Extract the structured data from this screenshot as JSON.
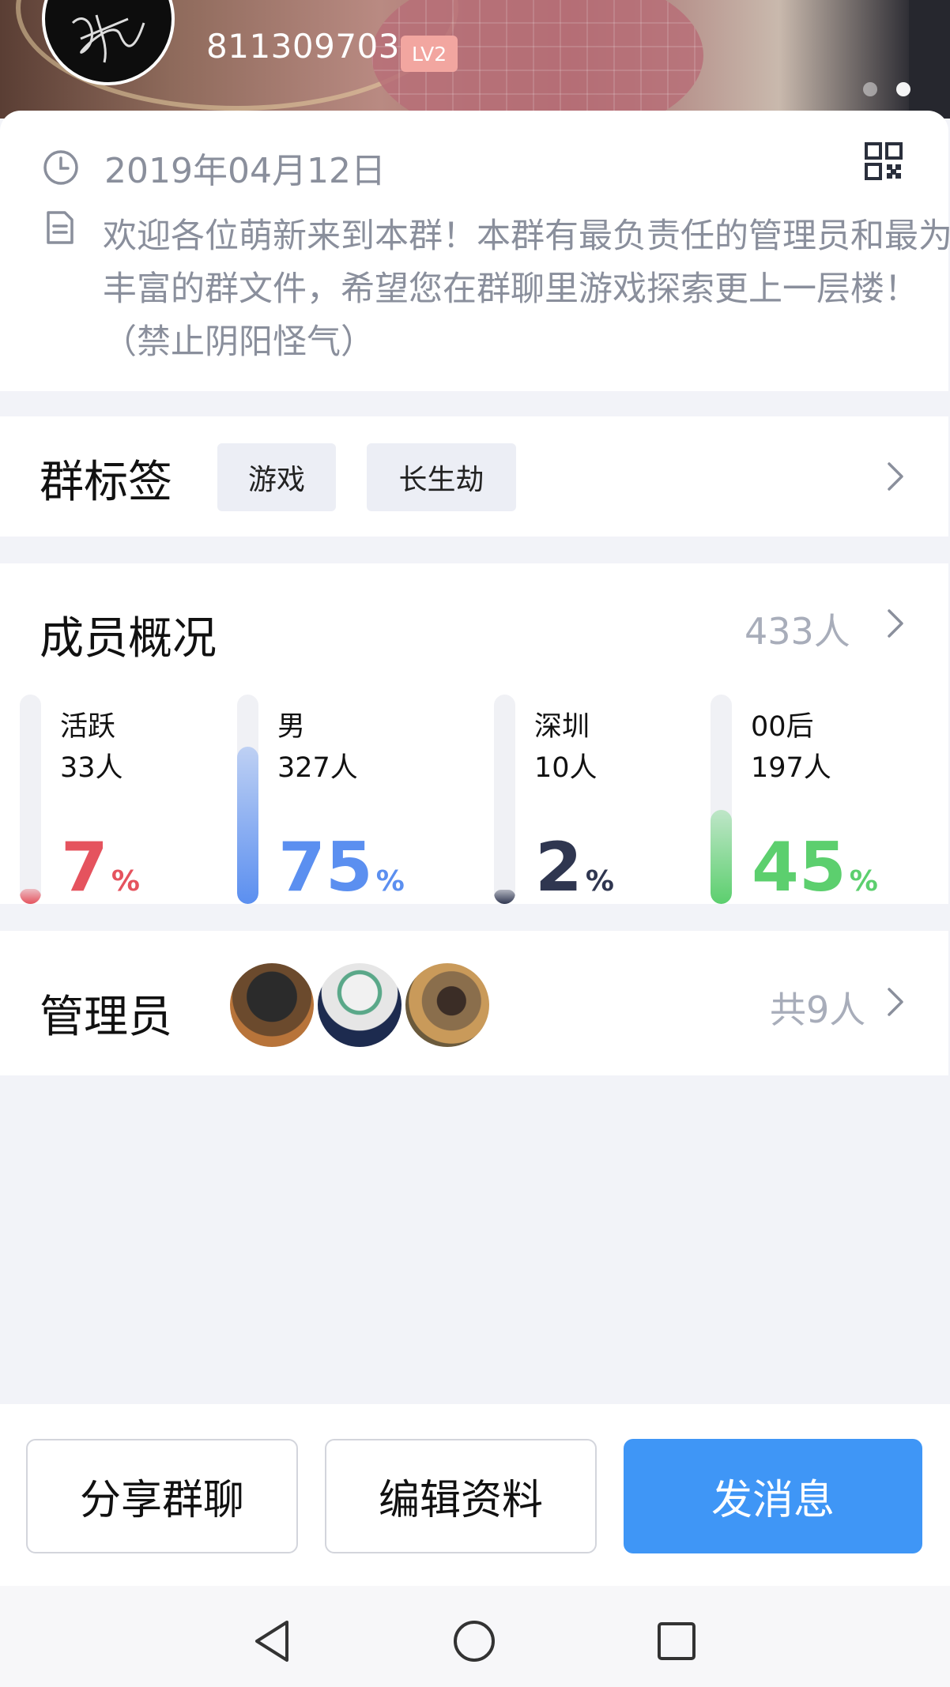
{
  "header": {
    "group_id": "811309703",
    "level": "LV2",
    "carousel_dots": 2,
    "carousel_active_index": 1
  },
  "info": {
    "date": "2019年04月12日",
    "description": "欢迎各位萌新来到本群！本群有最负责任的管理员和最为丰富的群文件，希望您在群聊里游戏探索更上一层楼！（禁止阴阳怪气）"
  },
  "tags_section": {
    "title": "群标签",
    "tags": [
      "游戏",
      "长生劫"
    ]
  },
  "members_section": {
    "title": "成员概况",
    "total": "433人",
    "stats": [
      {
        "label": "活跃",
        "count": "33人",
        "percent": "7",
        "percent_sign": "%",
        "fill_fraction": 0.07,
        "color": "#e5535e"
      },
      {
        "label": "男",
        "count": "327人",
        "percent": "75",
        "percent_sign": "%",
        "fill_fraction": 0.75,
        "color": "#5b8ff0"
      },
      {
        "label": "深圳",
        "count": "10人",
        "percent": "2",
        "percent_sign": "%",
        "fill_fraction": 0.02,
        "color": "#2f3650"
      },
      {
        "label": "00后",
        "count": "197人",
        "percent": "45",
        "percent_sign": "%",
        "fill_fraction": 0.45,
        "color": "#5ccf6e"
      }
    ]
  },
  "admins_section": {
    "title": "管理员",
    "count": "共9人",
    "avatars": [
      "admin-avatar-1",
      "admin-avatar-2",
      "admin-avatar-3"
    ]
  },
  "actions": {
    "share": "分享群聊",
    "edit": "编辑资料",
    "message": "发消息"
  },
  "colors": {
    "primary": "#3f96f6",
    "background": "#f2f3f8",
    "muted_text": "#8a8f9c",
    "level_badge": "#f2a6a0"
  },
  "icons": {
    "clock": "clock-icon",
    "document": "document-icon",
    "qr": "qr-code-icon",
    "chevron": "chevron-right-icon",
    "nav_back": "back-triangle-icon",
    "nav_home": "home-circle-icon",
    "nav_recent": "recent-square-icon"
  }
}
